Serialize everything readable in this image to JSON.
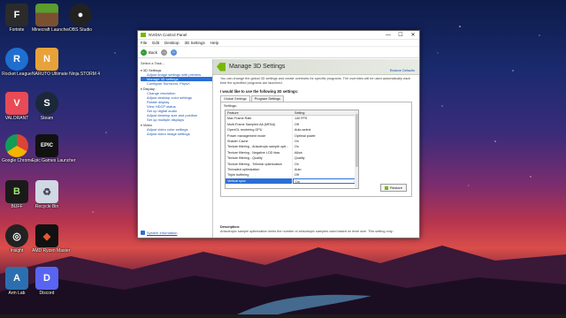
{
  "desktop": {
    "icons": [
      {
        "label": "Fortnite"
      },
      {
        "label": "Minecraft Launcher"
      },
      {
        "label": "OBS Studio"
      },
      {
        "label": "Rocket League"
      },
      {
        "label": "NARUTO Ultimate Ninja STORM 4"
      },
      {
        "label": "VALORANT"
      },
      {
        "label": "Steam"
      },
      {
        "label": "Google Chrome"
      },
      {
        "label": "Epic Games Launcher"
      },
      {
        "label": "BUFF"
      },
      {
        "label": "Recycle Bin"
      },
      {
        "label": "Insight"
      },
      {
        "label": "AMD Ryzen Master"
      },
      {
        "label": "Arm Lab"
      },
      {
        "label": "Discord"
      }
    ]
  },
  "window": {
    "title": "NVIDIA Control Panel",
    "controls": {
      "minimize": "—",
      "maximize": "☐",
      "close": "✕"
    },
    "menu": [
      "File",
      "Edit",
      "Desktop",
      "3D Settings",
      "Help"
    ],
    "toolbar": {
      "back": "Back"
    },
    "task_label": "Select a Task...",
    "tree": [
      {
        "group": "3D Settings",
        "items": [
          "Adjust image settings with preview",
          "Manage 3D settings",
          "Configure Surround, PhysX"
        ],
        "selected": 1
      },
      {
        "group": "Display",
        "items": [
          "Change resolution",
          "Adjust desktop color settings",
          "Rotate display",
          "View HDCP status",
          "Set up digital audio",
          "Adjust desktop size and position",
          "Set up multiple displays"
        ],
        "selected": -1
      },
      {
        "group": "Video",
        "items": [
          "Adjust video color settings",
          "Adjust video image settings"
        ],
        "selected": -1
      }
    ],
    "system_info": "System Information",
    "header": {
      "title": "Manage 3D Settings",
      "restore_defaults": "Restore Defaults"
    },
    "intro": "You can change the global 3D settings and create overrides for specific programs. The overrides will be used automatically each time the specified programs are launched.",
    "want_label": "I would like to use the following 3D settings:",
    "tabs": [
      "Global Settings",
      "Program Settings"
    ],
    "settings_label": "Settings:",
    "grid": {
      "head": {
        "feature": "Feature",
        "setting": "Setting"
      },
      "rows": [
        {
          "feature": "Max Frame Rate",
          "setting": "140 FPS"
        },
        {
          "feature": "Multi-Frame Sampled AA (MFAA)",
          "setting": "Off"
        },
        {
          "feature": "OpenGL rendering GPU",
          "setting": "Auto-select"
        },
        {
          "feature": "Power management mode",
          "setting": "Optimal power"
        },
        {
          "feature": "Shader Cache",
          "setting": "On"
        },
        {
          "feature": "Texture filtering - Anisotropic sample opti...",
          "setting": "On"
        },
        {
          "feature": "Texture filtering - Negative LOD bias",
          "setting": "Allow"
        },
        {
          "feature": "Texture filtering - Quality",
          "setting": "Quality"
        },
        {
          "feature": "Texture filtering - Trilinear optimization",
          "setting": "On"
        },
        {
          "feature": "Threaded optimization",
          "setting": "Auto"
        },
        {
          "feature": "Triple buffering",
          "setting": "Off"
        },
        {
          "feature": "Vertical sync",
          "setting": "On"
        }
      ],
      "selected_index": 11
    },
    "restore_button": "Restore",
    "description_label": "Description:",
    "description": "Anisotropic sample optimization limits the number of anisotropic samples used based on texel size. This setting only..."
  },
  "colors": {
    "nvidia_green": "#76b900",
    "selection_blue": "#2b6fd6",
    "link_blue": "#1f56b3"
  }
}
